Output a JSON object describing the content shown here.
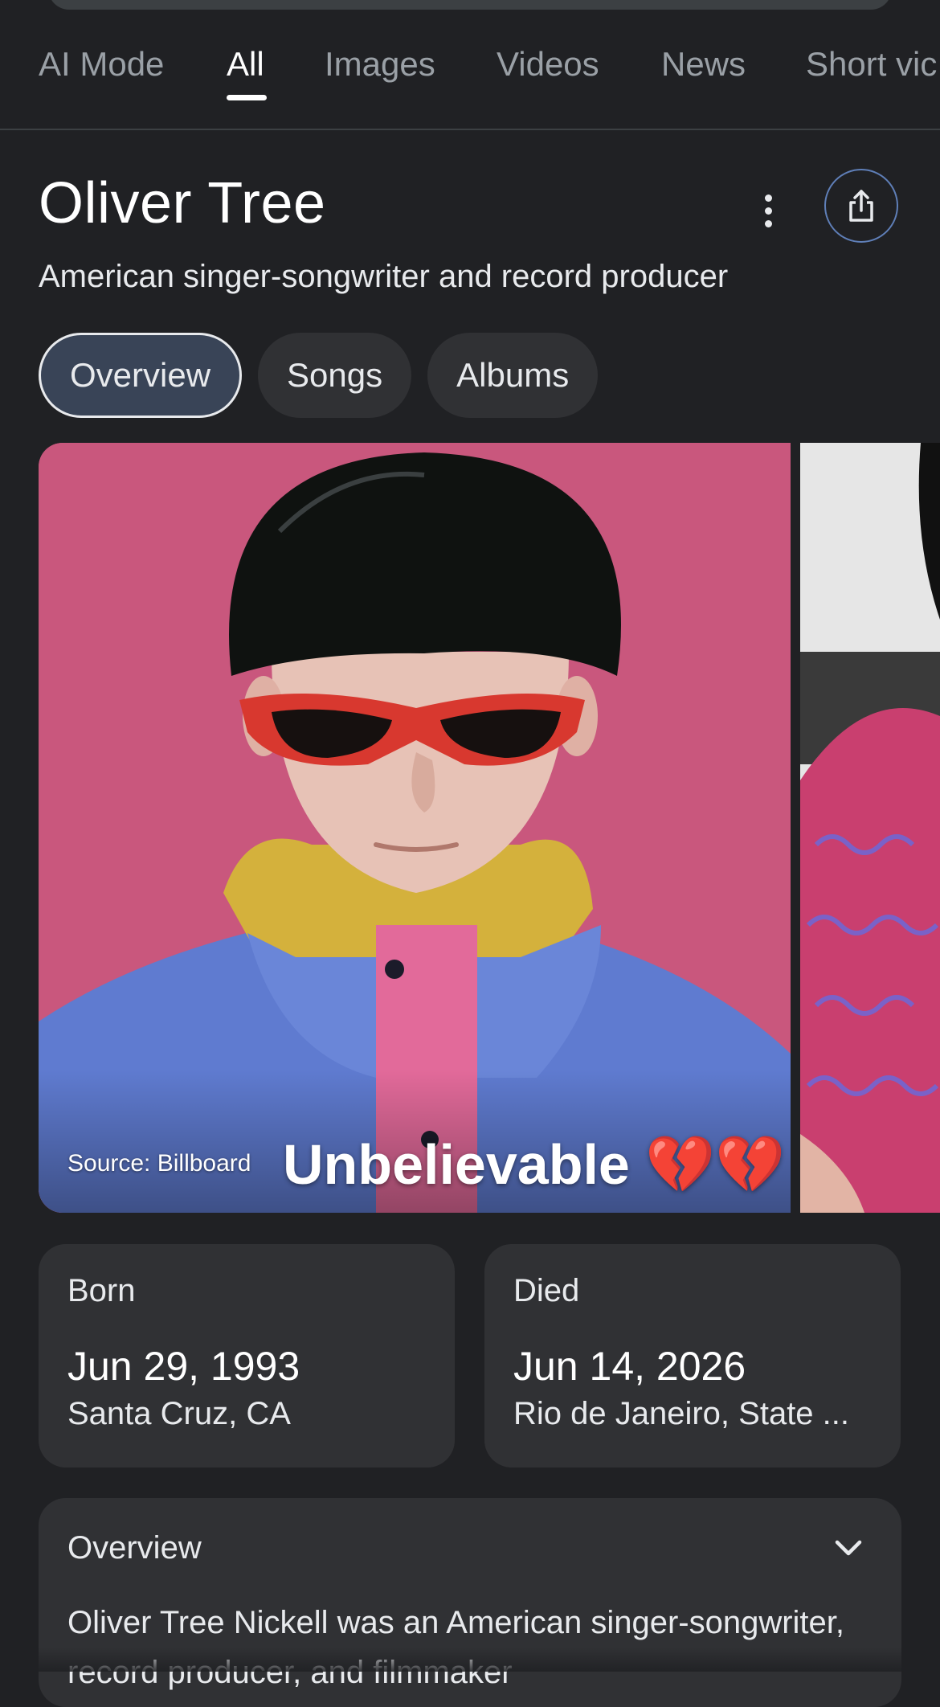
{
  "nav": {
    "tabs": [
      {
        "label": "AI Mode"
      },
      {
        "label": "All"
      },
      {
        "label": "Images"
      },
      {
        "label": "Videos"
      },
      {
        "label": "News"
      },
      {
        "label": "Short vic"
      }
    ],
    "active_tab": "All"
  },
  "entity": {
    "title": "Oliver Tree",
    "subtitle": "American singer-songwriter and record producer"
  },
  "chips": [
    {
      "label": "Overview",
      "selected": true
    },
    {
      "label": "Songs",
      "selected": false
    },
    {
      "label": "Albums",
      "selected": false
    }
  ],
  "hero": {
    "source": "Source: Billboard",
    "caption": "Unbelievable 💔💔"
  },
  "born": {
    "label": "Born",
    "date": "Jun 29, 1993",
    "place": "Santa Cruz, CA"
  },
  "died": {
    "label": "Died",
    "date": "Jun 14, 2026",
    "place": "Rio de Janeiro, State ..."
  },
  "overview": {
    "title": "Overview",
    "text": "Oliver Tree Nickell was an American singer-songwriter, record producer, and filmmaker"
  },
  "icons": {
    "more": "more-vert-icon",
    "share": "share-icon",
    "expand": "chevron-down-icon"
  },
  "colors": {
    "background": "#202124",
    "card": "#303134",
    "selected_chip": "#394457"
  }
}
